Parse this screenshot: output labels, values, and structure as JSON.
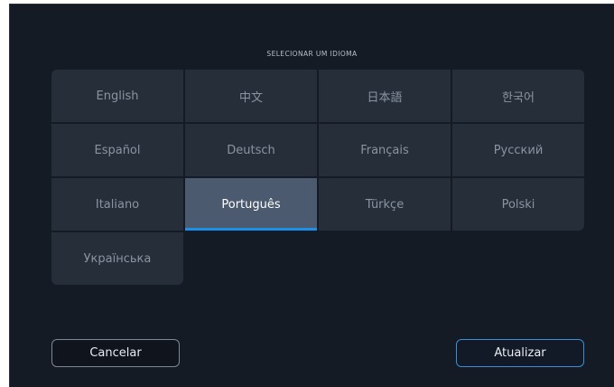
{
  "dialog": {
    "title": "SELECIONAR UM IDIOMA",
    "accent_color": "#1d8fe8",
    "selected_language": "Português",
    "languages": [
      "English",
      "中文",
      "日本語",
      "한국어",
      "Español",
      "Deutsch",
      "Français",
      "Русский",
      "Italiano",
      "Português",
      "Türkçe",
      "Polski",
      "Українська"
    ]
  },
  "buttons": {
    "cancel_label": "Cancelar",
    "update_label": "Atualizar"
  }
}
